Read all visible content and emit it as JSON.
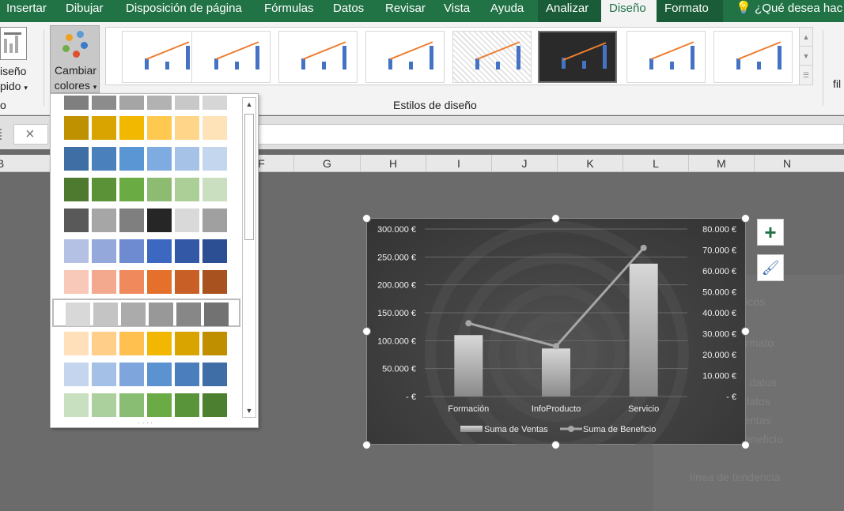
{
  "tabs": {
    "insertar": "Insertar",
    "dibujar": "Dibujar",
    "disposicion": "Disposición de página",
    "formulas": "Fórmulas",
    "datos": "Datos",
    "revisar": "Revisar",
    "vista": "Vista",
    "ayuda": "Ayuda",
    "analizar": "Analizar",
    "diseno": "Diseño",
    "formato": "Formato",
    "tell_me": "¿Qué desea hac"
  },
  "ribbon": {
    "quick_layout_line1": "iseño",
    "quick_layout_line2": "pido",
    "group_left_label": "o",
    "change_colors_line1": "Cambiar",
    "change_colors_line2": "colores",
    "styles_group_label": "Estilos de diseño",
    "right_cut_label": "fil"
  },
  "formula_bar": {
    "cancel_symbol": "×",
    "value": ""
  },
  "columns": [
    "B",
    "F",
    "G",
    "H",
    "I",
    "J",
    "K",
    "L",
    "M",
    "N"
  ],
  "palette_rows": [
    [
      "#7f7f7f",
      "#8c8c8c",
      "#a5a5a5",
      "#b2b2b2",
      "#c8c8c8",
      "#d6d6d6"
    ],
    [
      "#bf9000",
      "#d9a400",
      "#f2b800",
      "#ffc94f",
      "#ffd58a",
      "#ffe3b8"
    ],
    [
      "#3e6ea3",
      "#4a80bb",
      "#5b96d4",
      "#7eace0",
      "#a6c2e6",
      "#c4d6ed"
    ],
    [
      "#4d7a2f",
      "#5b9238",
      "#6aab43",
      "#8dbb72",
      "#accf98",
      "#cadfbf"
    ],
    [
      "#595959",
      "#a6a6a6",
      "#7f7f7f",
      "#262626",
      "#d9d9d9",
      "#a0a0a0"
    ],
    [
      "#b4c0e4",
      "#95a8dc",
      "#6e8bd2",
      "#3d68c2",
      "#3358a6",
      "#2c4e92"
    ],
    [
      "#f8c8b8",
      "#f2a98e",
      "#f08a5d",
      "#e4702c",
      "#c85f26",
      "#a8531f"
    ],
    [
      "#d8d8d8",
      "#c4c4c4",
      "#ababab",
      "#989898",
      "#878787",
      "#727272"
    ],
    [
      "#ffe0bb",
      "#ffcf8a",
      "#ffc04f",
      "#f2b700",
      "#d9a300",
      "#bf8f00"
    ],
    [
      "#c5d5ee",
      "#a5c0e6",
      "#7ea6dc",
      "#5b92d0",
      "#4a7ebc",
      "#3f6ea6"
    ],
    [
      "#c8dfc0",
      "#abd09d",
      "#8abd74",
      "#6bab45",
      "#5a943a",
      "#4c7f30"
    ]
  ],
  "chart_data": {
    "type": "bar",
    "categories": [
      "Formación",
      "InfoProducto",
      "Servicio"
    ],
    "series": [
      {
        "name": "Suma de Ventas",
        "type": "bar",
        "axis": "primary",
        "values": [
          110000,
          86000,
          238000
        ]
      },
      {
        "name": "Suma de Beneficio",
        "type": "line",
        "axis": "secondary",
        "values": [
          35000,
          24000,
          71000
        ]
      }
    ],
    "y_ticks": [
      "300.000 €",
      "250.000 €",
      "200.000 €",
      "150.000 €",
      "100.000 €",
      "50.000 €",
      "-  €"
    ],
    "y2_ticks": [
      "80.000 €",
      "70.000 €",
      "60.000 €",
      "50.000 €",
      "40.000 €",
      "30.000 €",
      "20.000 €",
      "10.000 €",
      "-  €"
    ],
    "ylim": [
      0,
      300000
    ],
    "y2lim": [
      0,
      80000
    ],
    "legend_position": "bottom",
    "grid": true,
    "colors": {
      "bars": "#c0c0c0",
      "line": "#a6a6a6",
      "grid": "#6a6a6a"
    }
  },
  "ghost_panel": [
    "eltros dinámicos",
    "Formato",
    "Formato de datos",
    "Formato a datos",
    "Suma de Ventas",
    "Suma de Beneficio",
    "línea de tendencia"
  ]
}
